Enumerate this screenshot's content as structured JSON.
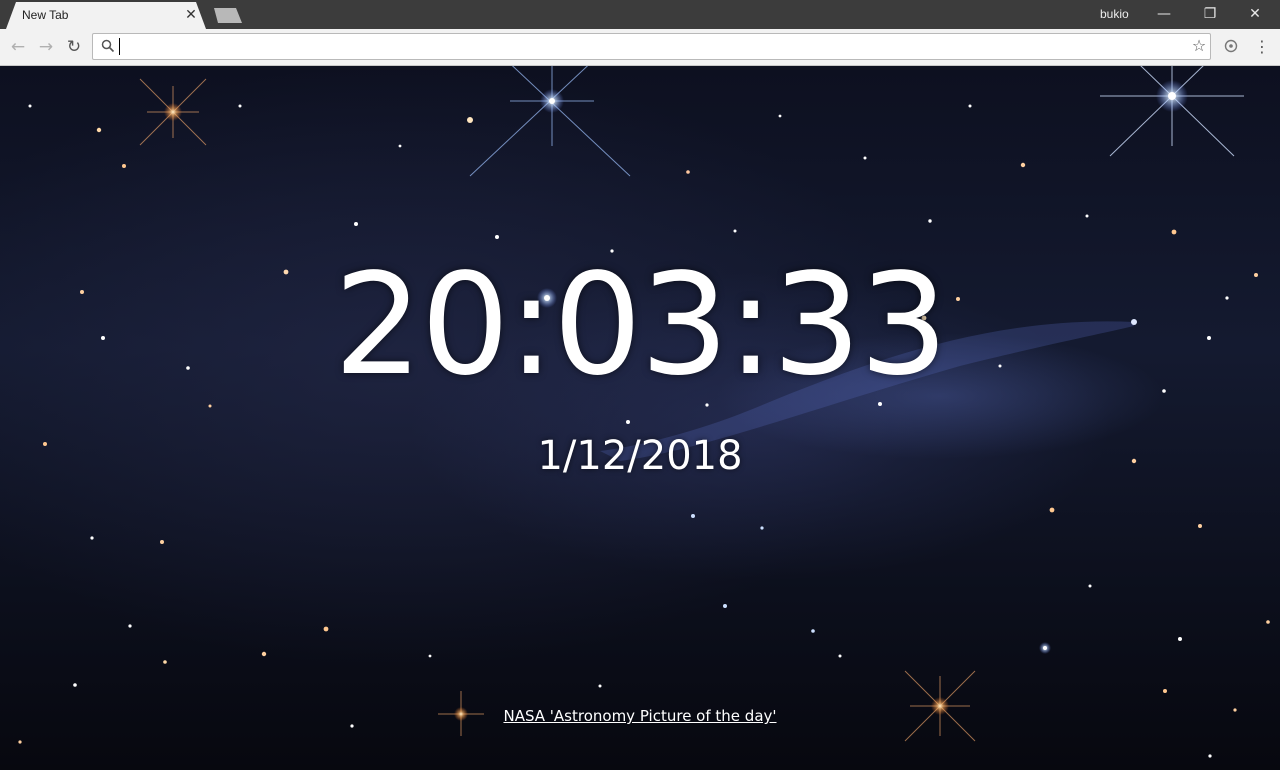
{
  "browser": {
    "tab": {
      "title": "New Tab",
      "close_glyph": "✕"
    },
    "profile_name": "bukio",
    "window_controls": {
      "minimize": "—",
      "restore": "❐",
      "close": "✕"
    }
  },
  "toolbar": {
    "back_glyph": "←",
    "forward_glyph": "→",
    "reload_glyph": "↻",
    "omnibox_value": "",
    "star_glyph": "☆",
    "menu_glyph": "⋮"
  },
  "page": {
    "time": "20:03:33",
    "date": "1/12/2018",
    "credit_link": "NASA 'Astronomy Picture of the day'"
  },
  "icons": {
    "search": "search-icon",
    "star": "star-icon",
    "extension": "extension-icon",
    "menu": "menu-icon"
  },
  "colors": {
    "titlebar": "#3c3c3c",
    "toolbar": "#f2f2f2",
    "text_on_sky": "#ffffff"
  }
}
